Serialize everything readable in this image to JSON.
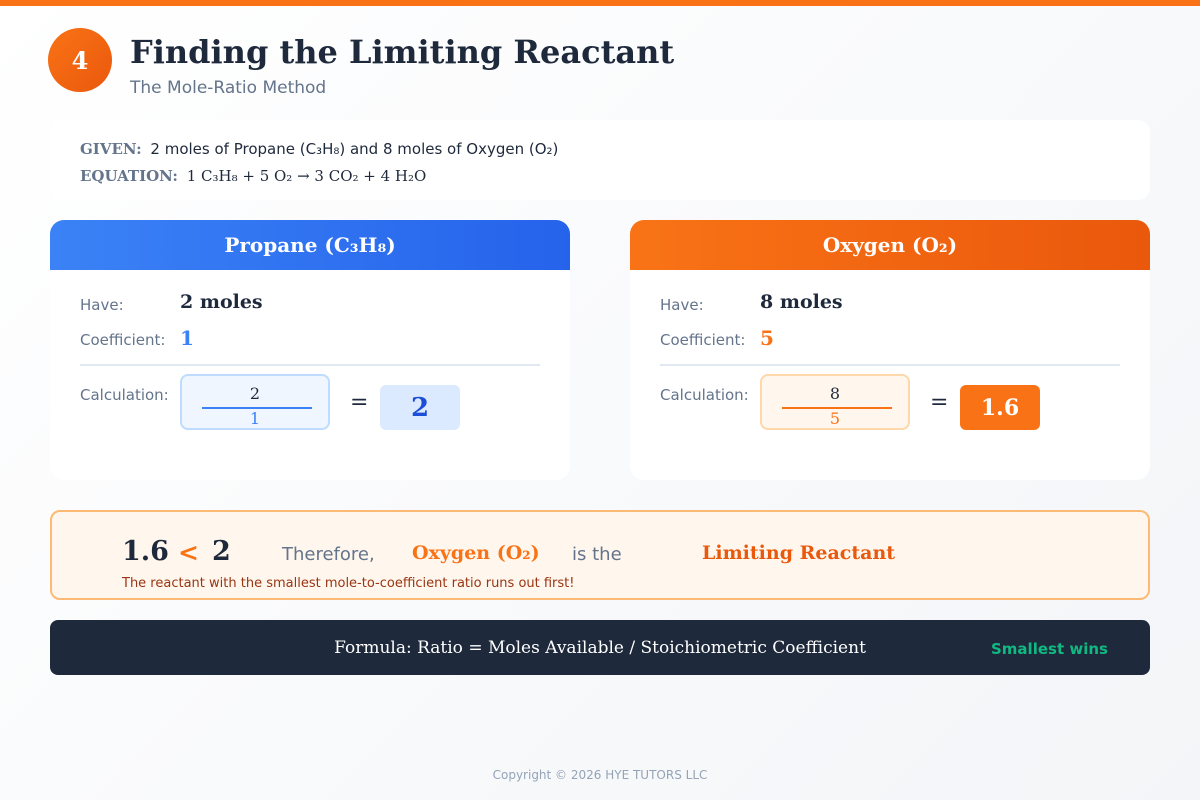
{
  "step_number": "4",
  "title": "Finding the Limiting Reactant",
  "subtitle": "The Mole-Ratio Method",
  "given": {
    "given_label": "GIVEN:",
    "given_text": "2 moles of Propane (C₃H₈) and 8 moles of Oxygen (O₂)",
    "equation_label": "EQUATION:",
    "equation_text": "1 C₃H₈ + 5 O₂ → 3 CO₂ + 4 H₂O"
  },
  "reactants": [
    {
      "name": "Propane (C₃H₈)",
      "have_label": "Have:",
      "have_value": "2 moles",
      "coefficient_label": "Coefficient:",
      "coefficient_value": "1",
      "calculation_label": "Calculation:",
      "numerator": "2",
      "denominator": "1",
      "equals": "=",
      "result": "2",
      "accent_color": "#3b82f6"
    },
    {
      "name": "Oxygen (O₂)",
      "have_label": "Have:",
      "have_value": "8 moles",
      "coefficient_label": "Coefficient:",
      "coefficient_value": "5",
      "calculation_label": "Calculation:",
      "numerator": "8",
      "denominator": "5",
      "equals": "=",
      "result": "1.6",
      "accent_color": "#f97316"
    }
  ],
  "conclusion": {
    "left_value": "1.6",
    "operator": "<",
    "right_value": "2",
    "therefore": "Therefore,",
    "reactant": "Oxygen (O₂)",
    "is_the": "is the",
    "verdict": "Limiting Reactant",
    "note": "The reactant with the smallest mole-to-coefficient ratio runs out first!"
  },
  "formula": {
    "text": "Formula: Ratio = Moles Available / Stoichiometric Coefficient",
    "tag": "Smallest wins"
  },
  "copyright": "Copyright © 2026 HYE TUTORS LLC",
  "colors": {
    "accent_orange": "#f97316",
    "accent_blue": "#3b82f6",
    "dark": "#1e293b",
    "success_green": "#10b981"
  }
}
